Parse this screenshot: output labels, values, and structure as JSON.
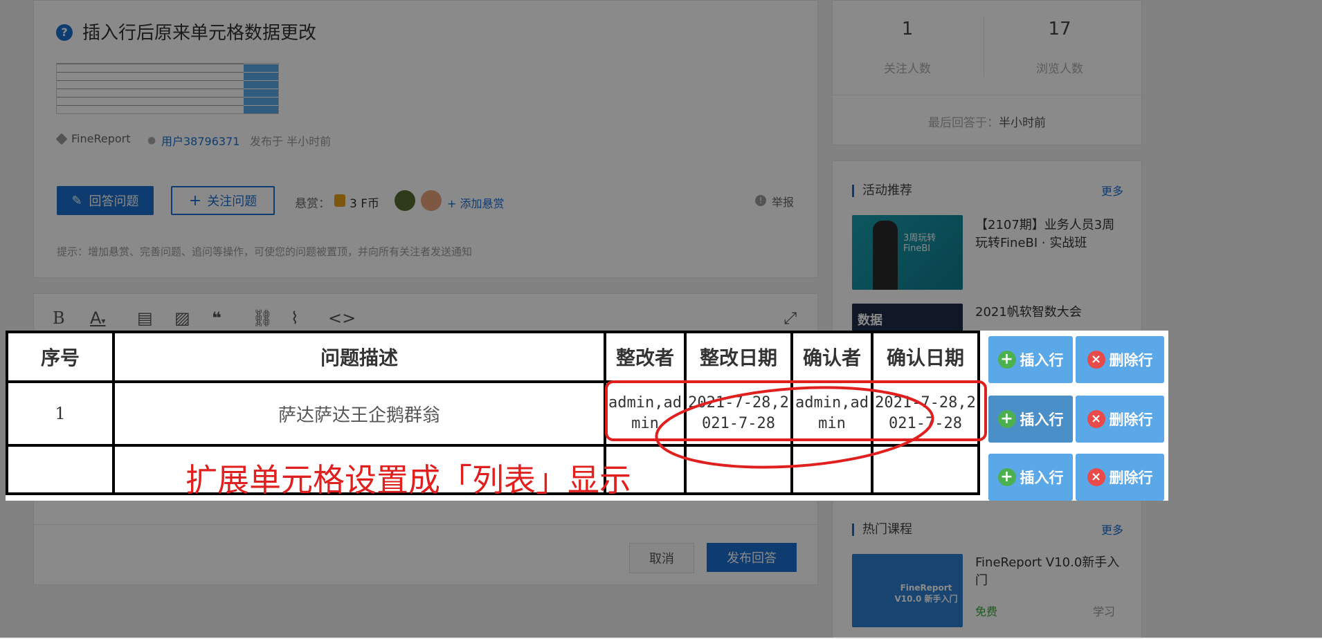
{
  "question": {
    "title": "插入行后原来单元格数据更改",
    "tag": "FineReport",
    "user": "用户38796371",
    "posted": "发布于 半小时前",
    "answer_button": "回答问题",
    "follow_button": "关注问题",
    "reward_label": "悬赏：",
    "reward_value": "3 F币",
    "add_reward": "+ 添加悬赏",
    "report": "举报",
    "hint": "提示：增加悬赏、完善问题、追问等操作，可使您的问题被置顶，并向所有关注者发送通知"
  },
  "editor": {
    "cancel": "取消",
    "publish": "发布回答"
  },
  "stats": {
    "followers_count": "1",
    "followers_label": "关注人数",
    "views_count": "17",
    "views_label": "浏览人数",
    "last_reply_label": "最后回答于：",
    "last_reply_value": "半小时前"
  },
  "activities": {
    "title": "活动推荐",
    "more": "更多",
    "items": [
      {
        "title": "【2107期】业务人员3周玩转FineBI · 实战班",
        "thumb_text": "3周玩转FineBI"
      },
      {
        "title": "2021帆软智数大会",
        "thumb_text": "数据"
      }
    ]
  },
  "courses": {
    "title": "热门课程",
    "more": "更多",
    "items": [
      {
        "title": "FineReport V10.0新手入门",
        "price": "免费",
        "action": "学习",
        "thumb_text": "FineReport V10.0 新手入门"
      }
    ]
  },
  "overlay": {
    "headers": [
      "序号",
      "问题描述",
      "整改者",
      "整改日期",
      "确认者",
      "确认日期"
    ],
    "row1": {
      "no": "1",
      "desc": "萨达萨达王企鹅群翁",
      "fixer": "admin,admin",
      "fix_date": "2021-7-28,2021-7-28",
      "confirmer": "admin,admin",
      "confirm_date": "2021-7-28,2021-7-28"
    },
    "insert_label": "插入行",
    "delete_label": "删除行",
    "annotation": "扩展单元格设置成「列表」显示",
    "annotation_color": "#e0201f"
  }
}
